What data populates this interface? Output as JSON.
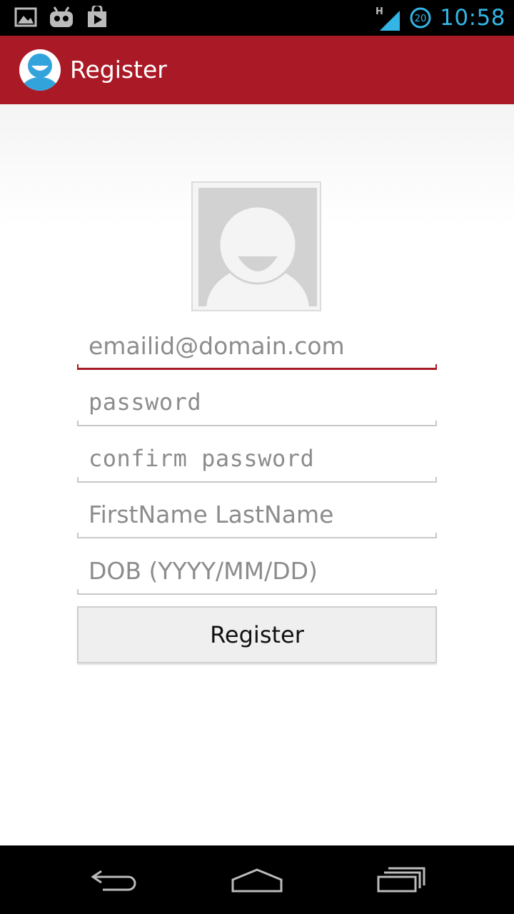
{
  "status_bar": {
    "time": "10:58",
    "network_type": "H",
    "badge_count": "20",
    "left_icons": [
      "image-notification-icon",
      "android-robot-icon",
      "play-store-icon"
    ],
    "clock_color": "#33b5e5"
  },
  "action_bar": {
    "title": "Register",
    "color": "#aa1a26"
  },
  "form": {
    "email": {
      "placeholder": "emailid@domain.com",
      "value": ""
    },
    "password": {
      "placeholder": "password",
      "value": ""
    },
    "confirm_password": {
      "placeholder": "confirm password",
      "value": ""
    },
    "full_name": {
      "placeholder": "FirstName LastName",
      "value": ""
    },
    "dob": {
      "placeholder": "DOB (YYYY/MM/DD)",
      "value": ""
    },
    "register_label": "Register"
  },
  "nav_bar": {
    "buttons": [
      "back-icon",
      "home-icon",
      "recent-apps-icon"
    ]
  }
}
